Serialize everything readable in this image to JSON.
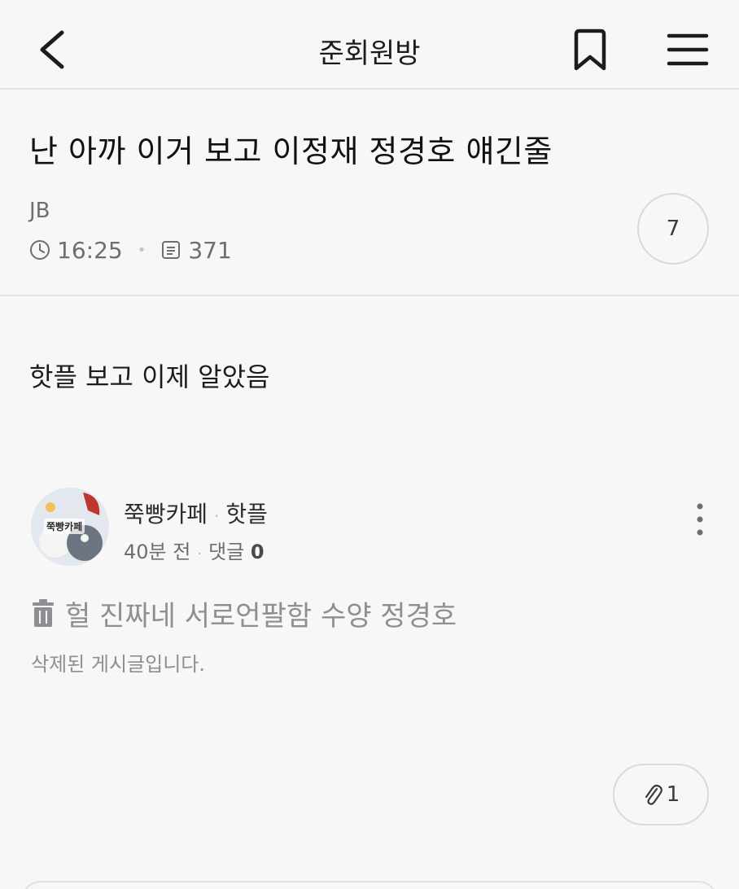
{
  "header": {
    "title": "준회원방"
  },
  "post": {
    "title": "난 아까 이거 보고 이정재 정경호 얘긴줄",
    "author": "JB",
    "time": "16:25",
    "views": "371",
    "comment_count": "7",
    "body": "핫플 보고 이제 알았음"
  },
  "embed": {
    "cafe_name": "쭉빵카페",
    "board": "핫플",
    "age": "40분 전",
    "comments_label": "댓글",
    "comments_count": "0",
    "avatar_text": "쭉빵카페",
    "deleted_title": "헐 진짜네 서로언팔함 수양 정경호",
    "deleted_message": "삭제된 게시글입니다."
  },
  "attachments": {
    "count": "1"
  },
  "icons": {
    "back": "chevron-left-icon",
    "bookmark": "bookmark-icon",
    "menu": "hamburger-menu-icon",
    "clock": "clock-icon",
    "views": "document-icon",
    "kebab": "more-vertical-icon",
    "trash": "trash-icon",
    "attach": "paperclip-icon"
  }
}
